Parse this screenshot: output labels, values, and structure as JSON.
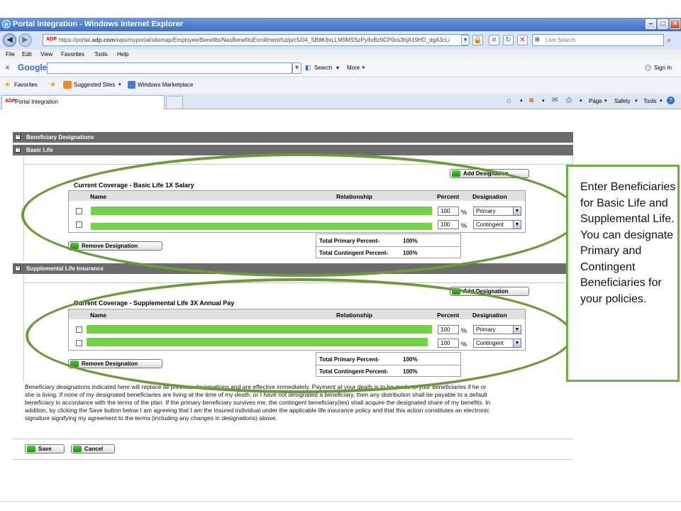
{
  "window": {
    "title": "Portal Integration - Windows Internet Explorer"
  },
  "address_bar": {
    "url_prefix": "https://portal.",
    "url_domain": "adp.com",
    "url_rest": "/wps/myportal/sitemap/Employee/Benefits/NasBenefitsEnrollment/!ut/p/c5/04_SB8K8xLLM9MSSzPy8xBz9CP0os3hjA19HD_dgA3cLi"
  },
  "live_search": {
    "placeholder": "Live Search"
  },
  "menu": [
    "File",
    "Edit",
    "View",
    "Favorites",
    "Tools",
    "Help"
  ],
  "google_bar": {
    "close": "×",
    "logo": "Google",
    "search_label": "Search",
    "more_label": "More",
    "sign_in": "Sign In"
  },
  "favorites_bar": {
    "favorites": "Favorites",
    "suggested": "Suggested Sites",
    "marketplace": "Windows Marketplace"
  },
  "tab": {
    "label": "Portal Integration"
  },
  "command_bar": {
    "page": "Page",
    "safety": "Safety",
    "tools": "Tools"
  },
  "sections": {
    "beneficiary": "Beneficiary Designations",
    "basic": "Basic Life",
    "supplemental": "Supplemental Life Insurance"
  },
  "basic_life": {
    "add_button": "Add Designation",
    "coverage_title": "Current Coverage - Basic Life 1X Salary",
    "columns": {
      "name": "Name",
      "relationship": "Relationship",
      "percent": "Percent",
      "designation": "Designation"
    },
    "rows": [
      {
        "percent": "100",
        "designation": "Primary"
      },
      {
        "percent": "100",
        "designation": "Contingent"
      }
    ],
    "total_primary_label": "Total Primary Percent-",
    "total_primary": "100%",
    "total_contingent_label": "Total Contingent Percent-",
    "total_contingent": "100%",
    "remove_button": "Remove Designation"
  },
  "supplemental_life": {
    "add_button": "Add Designation",
    "coverage_title": "Current Coverage - Supplemental Life 3X Annual Pay",
    "columns": {
      "name": "Name",
      "relationship": "Relationship",
      "percent": "Percent",
      "designation": "Designation"
    },
    "rows": [
      {
        "percent": "100",
        "designation": "Primary"
      },
      {
        "percent": "100",
        "designation": "Contingent"
      }
    ],
    "total_primary_label": "Total Primary Percent-",
    "total_primary": "100%",
    "total_contingent_label": "Total Contingent Percent-",
    "total_contingent": "100%",
    "remove_button": "Remove Designation"
  },
  "percent_sign": "%",
  "disclaimer": "Beneficiary designations indicated here will replace all previous designations and are effective immediately. Payment at your death is to be made to your beneficiaries if he or she is living. If none of my designated beneficiaries are living at the time of my death, or I have not designated a beneficiary, then any distribution shall be payable to a default beneficiary in accordance with the terms of the plan. If the primary beneficiary survives me, the contingent beneficiary(ies) shall acquire the designated share of my benefits. In addition, by clicking the Save button below I am agreeing that I am the insured individual under the applicable life insurance policy and that this action constitutes an electronic signature signifying my agreement to the terms (including any changes in designations) above.",
  "buttons": {
    "save": "Save",
    "cancel": "Cancel"
  },
  "callout": "Enter Beneficiaries for Basic Life and Supplemental Life. You can designate Primary and Contingent Beneficiaries for your policies.",
  "colors": {
    "accent_green": "#6f9a3a",
    "redaction_green": "#72d246",
    "section_gray": "#6b6b6b"
  }
}
